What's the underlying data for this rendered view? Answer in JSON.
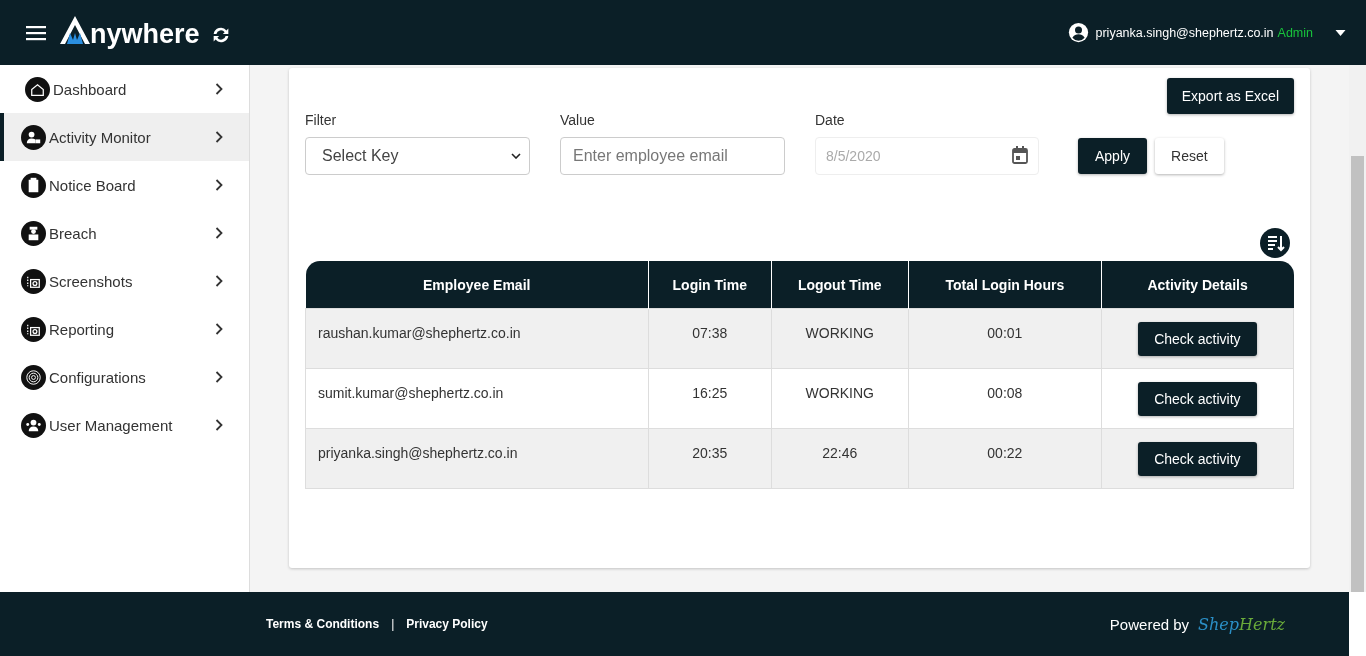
{
  "header": {
    "logo_text": "nywhere",
    "user_email": "priyanka.singh@shephertz.co.in",
    "role": "Admin"
  },
  "sidebar": {
    "items": [
      {
        "label": "Dashboard",
        "kind": "home",
        "selected": false
      },
      {
        "label": "Activity Monitor",
        "kind": "person",
        "selected": true
      },
      {
        "label": "Notice Board",
        "kind": "clipboard",
        "selected": false
      },
      {
        "label": "Breach",
        "kind": "spy",
        "selected": false
      },
      {
        "label": "Screenshots",
        "kind": "camera",
        "selected": false
      },
      {
        "label": "Reporting",
        "kind": "camera",
        "selected": false
      },
      {
        "label": "Configurations",
        "kind": "target",
        "selected": false
      },
      {
        "label": "User Management",
        "kind": "users",
        "selected": false
      }
    ]
  },
  "export_button": "Export as Excel",
  "filters": {
    "filter": {
      "label": "Filter",
      "value": "Select Key"
    },
    "value": {
      "label": "Value",
      "placeholder": "Enter employee email"
    },
    "date": {
      "label": "Date",
      "value": "8/5/2020"
    },
    "apply": "Apply",
    "reset": "Reset"
  },
  "table": {
    "columns": [
      "Employee Email",
      "Login Time",
      "Logout Time",
      "Total Login Hours",
      "Activity Details"
    ],
    "rows": [
      {
        "email": "raushan.kumar@shephertz.co.in",
        "login": "07:38",
        "logout": "WORKING",
        "hours": "00:01",
        "action": "Check activity"
      },
      {
        "email": "sumit.kumar@shephertz.co.in",
        "login": "16:25",
        "logout": "WORKING",
        "hours": "00:08",
        "action": "Check activity"
      },
      {
        "email": "priyanka.singh@shephertz.co.in",
        "login": "20:35",
        "logout": "22:46",
        "hours": "00:22",
        "action": "Check activity"
      }
    ]
  },
  "footer": {
    "links": [
      "Terms & Conditions",
      "Privacy Policy"
    ],
    "separator": "|",
    "powered_by": "Powered by",
    "brand": [
      "Shep",
      "Hertz"
    ]
  }
}
